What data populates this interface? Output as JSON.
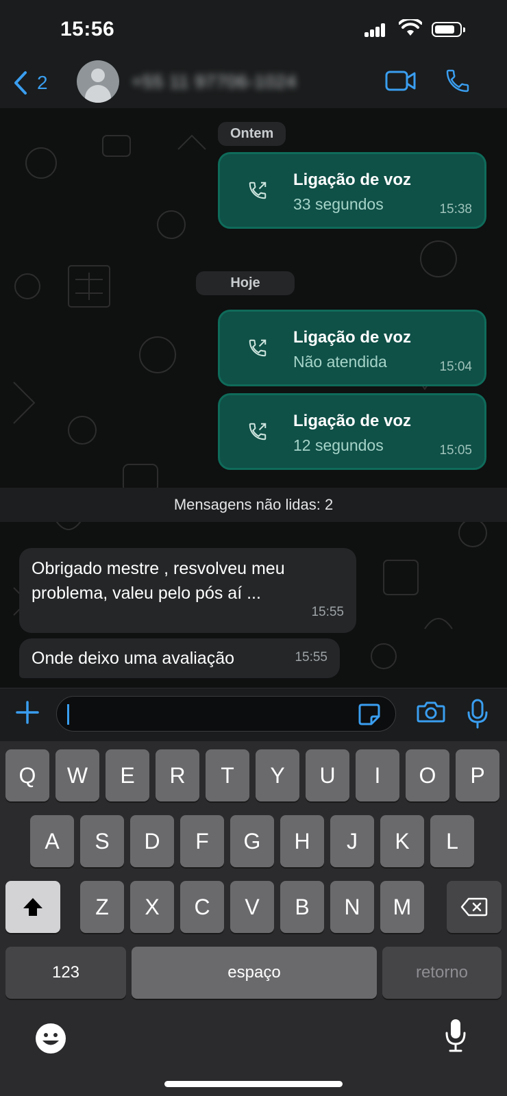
{
  "status": {
    "time": "15:56"
  },
  "header": {
    "back_count": "2",
    "contact": "+55 11 97706-1024"
  },
  "chat": {
    "date_yesterday": "Ontem",
    "date_today": "Hoje",
    "calls": [
      {
        "title": "Ligação de voz",
        "detail": "33 segundos",
        "time": "15:38"
      },
      {
        "title": "Ligação de voz",
        "detail": "Não atendida",
        "time": "15:04"
      },
      {
        "title": "Ligação de voz",
        "detail": "12 segundos",
        "time": "15:05"
      }
    ],
    "unread_label": "Mensagens não lidas: 2",
    "incoming": [
      {
        "line1": "Obrigado mestre , resvolveu meu",
        "line2": "problema, valeu pelo pós aí ...",
        "time": "15:55"
      },
      {
        "line1": "Onde deixo uma avaliação",
        "time": "15:55"
      }
    ]
  },
  "input": {
    "value": ""
  },
  "keyboard": {
    "row1": [
      "Q",
      "W",
      "E",
      "R",
      "T",
      "Y",
      "U",
      "I",
      "O",
      "P"
    ],
    "row2": [
      "A",
      "S",
      "D",
      "F",
      "G",
      "H",
      "J",
      "K",
      "L"
    ],
    "row3": [
      "Z",
      "X",
      "C",
      "V",
      "B",
      "N",
      "M"
    ],
    "numbers": "123",
    "space": "espaço",
    "return": "retorno"
  },
  "colors": {
    "accent": "#3a9ef0",
    "outgoing_bubble": "#0f5047",
    "incoming_bubble": "#242628"
  }
}
